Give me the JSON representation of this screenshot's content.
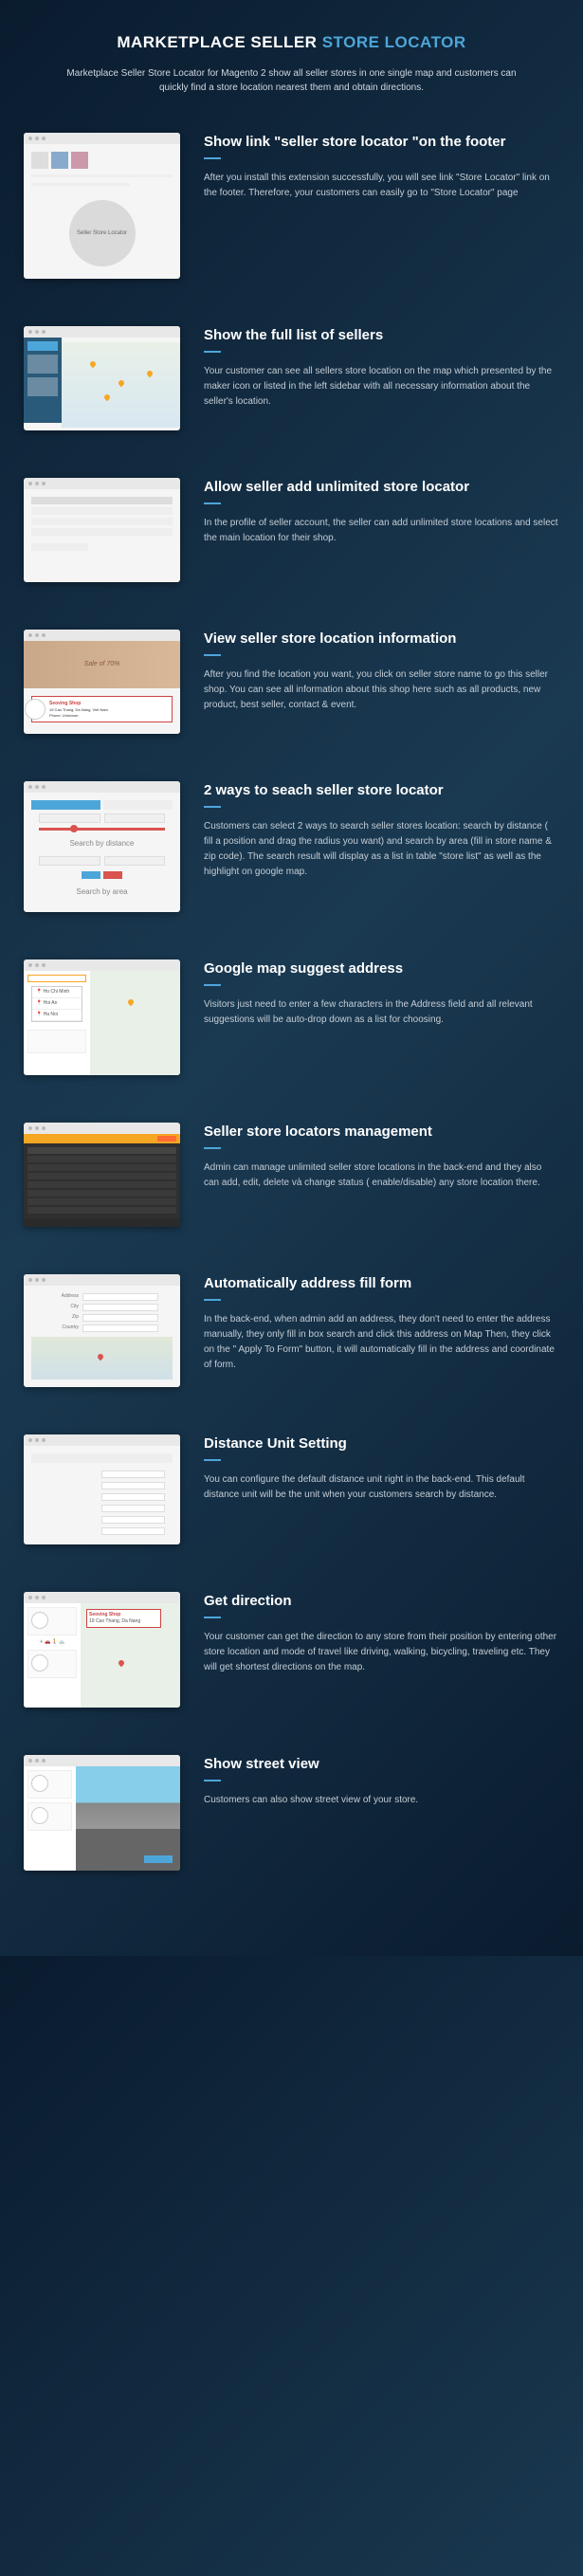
{
  "title": {
    "prefix": "MARKETPLACE SELLER ",
    "highlight": "STORE LOCATOR"
  },
  "subtitle": "Marketplace Seller Store Locator for Magento 2 show all seller stores in one single map and customers can quickly find a store location nearest them and obtain directions.",
  "features": [
    {
      "title": "Show link \"seller store locator \"on the footer",
      "desc": "After you install this extension successfully, you will see link \"Store Locator\" link on the footer. Therefore, your customers can easily go to \"Store Locator\" page",
      "screenshot": {
        "type": "footer",
        "circle_label": "Seller Store Locator"
      }
    },
    {
      "title": "Show the full list of sellers",
      "desc": "Your customer can see all sellers store location on the map which presented by the maker icon or listed in the left sidebar with all necessary information about the seller's location.",
      "screenshot": {
        "type": "map-list"
      }
    },
    {
      "title": "Allow seller add unlimited store locator",
      "desc": "In the profile of seller account, the seller can add unlimited store locations and select the main location for their shop.",
      "screenshot": {
        "type": "table"
      }
    },
    {
      "title": "View seller store location information",
      "desc": "After you find the location you want, you click on seller store name to go this seller shop. You can see all information about this shop here such as all products, new product, best seller, contact & event.",
      "screenshot": {
        "type": "popup",
        "banner_text": "Sale of 70%",
        "popup_title": "Seoving Shop"
      }
    },
    {
      "title": "2  ways to seach seller store locator",
      "desc": "Customers can select 2 ways to search seller stores location: search by distance ( fill a position and drag the radius you want) and search by area (fill in store name & zip code). The search result will display as a list in table \"store list\" as well as the highlight on google map.",
      "screenshot": {
        "type": "search",
        "label1": "Search by distance",
        "label2": "Search by area"
      }
    },
    {
      "title": "Google map suggest address",
      "desc": "Visitors just need to enter a few characters in the Address field and all relevant suggestions will be auto-drop down as a list for choosing.",
      "screenshot": {
        "type": "suggest",
        "items": [
          "Ho Chi Minh",
          "Hoi An",
          "Ha Noi"
        ]
      }
    },
    {
      "title": "Seller store locators management",
      "desc": "Admin can manage unlimited seller store locations in the back-end and they also can add, edit,  delete và change status ( enable/disable) any store location there.",
      "screenshot": {
        "type": "admin"
      }
    },
    {
      "title": "Automatically address fill form",
      "desc": "In the back-end, when admin add an address, they don't need to enter the address manually, they only fill in box search and click this address on Map Then, they click on the \" Apply To Form\" button, it will automatically fill in the address and coordinate of form.",
      "screenshot": {
        "type": "form-map"
      }
    },
    {
      "title": "Distance Unit Setting",
      "desc": "You can configure the default distance unit right in the back-end. This default distance unit will be the unit when your customers search by distance.",
      "screenshot": {
        "type": "config"
      }
    },
    {
      "title": "Get direction",
      "desc": "Your customer can get the direction to any store from their position by entering other store location and mode of travel like driving, walking, bicycling, traveling etc. They will get shortest directions on the map.",
      "screenshot": {
        "type": "direction",
        "box_title": "Seoving Shop"
      }
    },
    {
      "title": "Show street view",
      "desc": "Customers can also show street view of your store.",
      "screenshot": {
        "type": "street"
      }
    }
  ]
}
